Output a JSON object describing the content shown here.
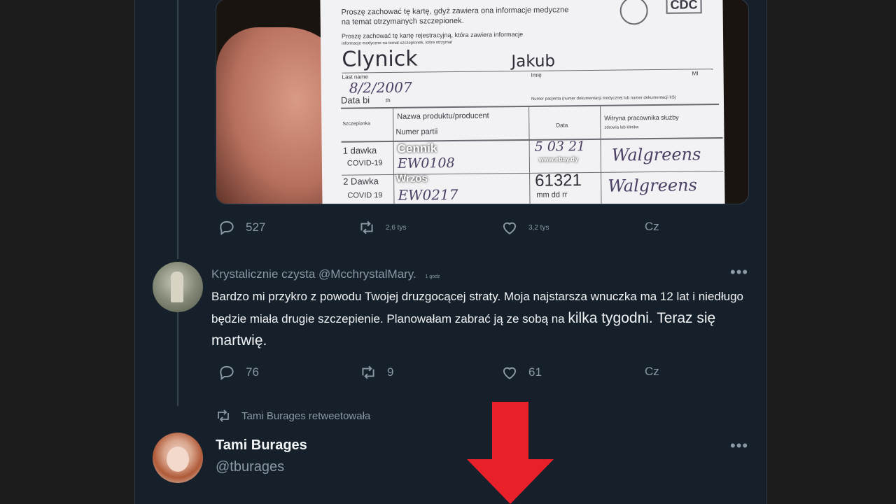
{
  "card": {
    "keep_text_1": "Proszę zachować tę kartę, gdyż zawiera ona informacje medyczne",
    "keep_text_2": "na temat otrzymanych szczepionek.",
    "keep_text_3": "Proszę zachować tę kartę rejestracyjną, która zawiera informacje",
    "keep_text_4": "informacje medyczne na temat szczepionek, które otrzymał",
    "cdc_label": "CDC",
    "last_name": "Clynick",
    "first_name": "Jakub",
    "last_name_label": "Last name",
    "first_name_label": "Imię",
    "mi_label": "MI",
    "dob_value": "8/2/2007",
    "dob_label": "Data bi",
    "dob_suffix": "th",
    "patient_number_label": "Numer pacjenta (numer dokumentacji medycznej lub numer dokumentacji IIS)",
    "col_vaccine": "Szczepionka",
    "col_product": "Nazwa produktu/producent",
    "col_lot": "Numer partii",
    "col_date": "Data",
    "col_site": "Witryna pracownika służby",
    "col_site_2": "zdrowia lub klinika",
    "dose1_label": "1 dawka",
    "dose1_type": "COVID-19",
    "dose1_product": "Cennik",
    "dose1_lot": "EW0108",
    "dose1_date": "5 03 21",
    "dose1_date_overlay": "www.ebay.dy",
    "dose1_site": "Walgreens",
    "dose2_label": "2 Dawka",
    "dose2_type": "COVID 19",
    "dose2_product": "Wrzos",
    "dose2_lot": "EW0217",
    "dose2_date": "61321",
    "dose2_date_hint": "mm dd rr",
    "dose2_site": "Walgreens"
  },
  "tweet1": {
    "replies": "527",
    "retweets": "2,6 tys",
    "likes": "3,2 tys",
    "share": "Cz"
  },
  "tweet2": {
    "author": "Krystalicznie czysta @McchrystalMary.",
    "time": "1 godz",
    "text": "Bardzo mi przykro z powodu Twojej druzgocącej straty. Moja najstarsza wnuczka ma 12 lat i niedługo będzie miała drugie szczepienie. Planowałam zabrać ją ze sobą na",
    "text_large": "kilka tygodni. Teraz się martwię.",
    "replies": "76",
    "retweets": "9",
    "likes": "61",
    "share": "Cz",
    "more": "•••"
  },
  "tweet3": {
    "retweeted_by": "Tami Burages retweetowała",
    "name": "Tami Burages",
    "handle": "@tburages",
    "more": "•••"
  },
  "colors": {
    "feed_bg": "#15202b",
    "muted": "#8b98a5",
    "arrow_red": "#e8202a"
  }
}
